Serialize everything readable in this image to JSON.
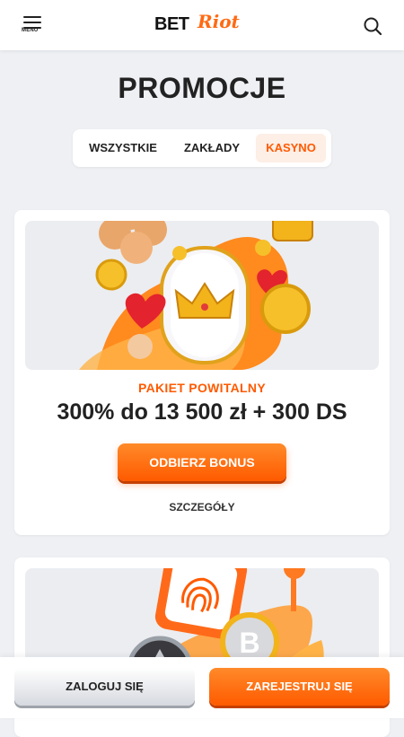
{
  "header": {
    "menu_label": "MENU",
    "logo_bet": "BET",
    "logo_riot": "Riot"
  },
  "page": {
    "title": "PROMOCJE"
  },
  "tabs": [
    {
      "label": "WSZYSTKIE",
      "active": false
    },
    {
      "label": "ZAKŁADY",
      "active": false
    },
    {
      "label": "KASYNO",
      "active": true
    }
  ],
  "promos": [
    {
      "subtitle": "PAKIET POWITALNY",
      "headline": "300% do 13 500 zł + 300 DS",
      "cta": "ODBIERZ BONUS",
      "details": "SZCZEGÓŁY",
      "art_icons": [
        "clover-icon",
        "crown-icon",
        "heart-icon",
        "coin-icon",
        "slot-reel-icon"
      ]
    },
    {
      "art_icons": [
        "fingerprint-icon",
        "bitcoin-coin-icon",
        "ethereum-coin-icon"
      ]
    }
  ],
  "bottom_bar": {
    "login": "ZALOGUJ SIĘ",
    "register": "ZAREJESTRUJ SIĘ"
  },
  "colors": {
    "accent": "#ff5a00",
    "background": "#eef0f4",
    "card": "#ffffff"
  }
}
